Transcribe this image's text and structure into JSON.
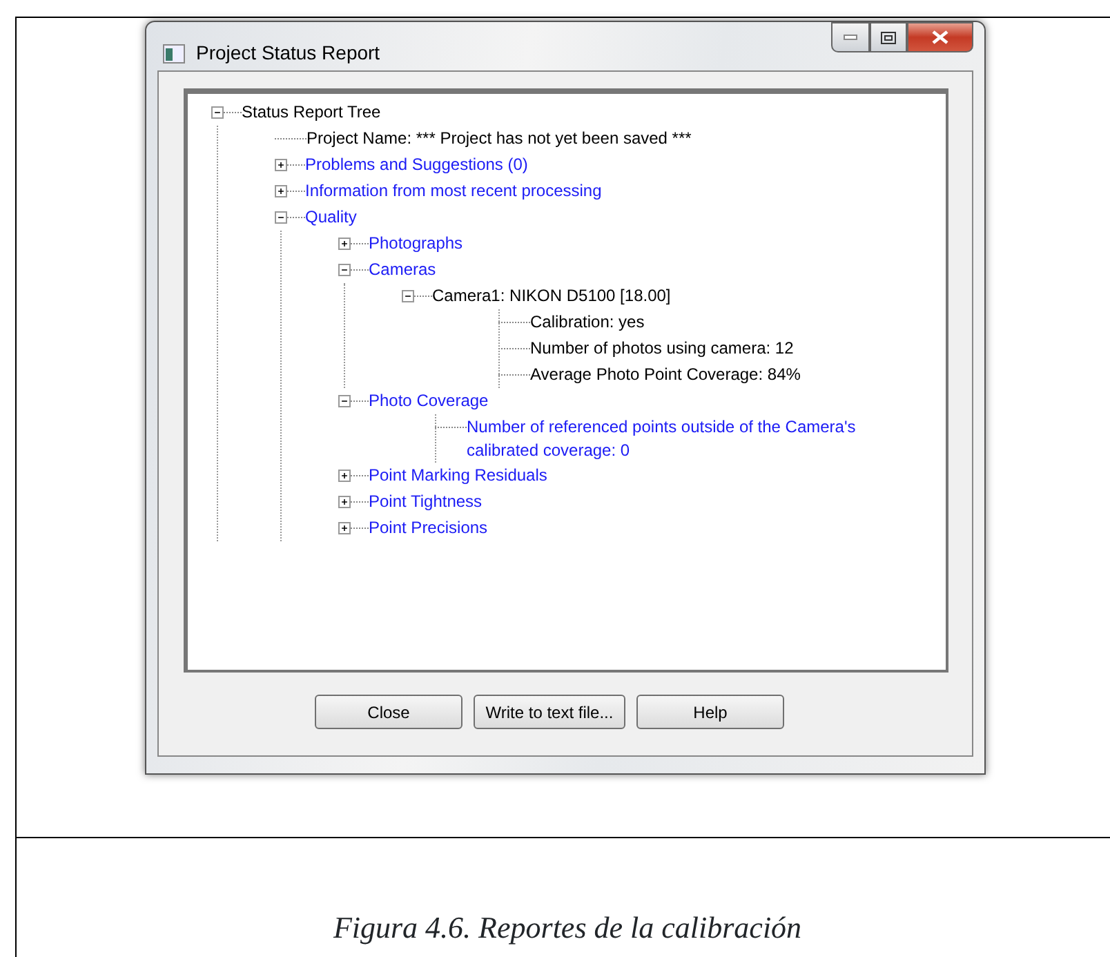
{
  "window": {
    "title": "Project Status Report"
  },
  "tree": [
    {
      "text": "Status Report Tree",
      "kind": "info",
      "expanded": true,
      "children": [
        {
          "text": "Project Name: *** Project has not yet been saved ***",
          "kind": "info"
        },
        {
          "text": "Problems and Suggestions (0)",
          "kind": "category",
          "expanded": false
        },
        {
          "text": "Information from most recent processing",
          "kind": "category",
          "expanded": false
        },
        {
          "text": "Quality",
          "kind": "category",
          "expanded": true,
          "children": [
            {
              "text": "Photographs",
              "kind": "category",
              "expanded": false
            },
            {
              "text": "Cameras",
              "kind": "category",
              "expanded": true,
              "children": [
                {
                  "text": "Camera1: NIKON D5100 [18.00]",
                  "kind": "info",
                  "expanded": true,
                  "children": [
                    {
                      "text": "Calibration: yes",
                      "kind": "info"
                    },
                    {
                      "text": "Number of photos using camera: 12",
                      "kind": "info"
                    },
                    {
                      "text": "Average Photo Point Coverage: 84%",
                      "kind": "info"
                    }
                  ]
                }
              ]
            },
            {
              "text": "Photo Coverage",
              "kind": "category",
              "expanded": true,
              "children": [
                {
                  "text": "Number of referenced points outside of the Camera's calibrated coverage: 0",
                  "kind": "category"
                }
              ]
            },
            {
              "text": "Point Marking Residuals",
              "kind": "category",
              "expanded": false
            },
            {
              "text": "Point Tightness",
              "kind": "category",
              "expanded": false
            },
            {
              "text": "Point Precisions",
              "kind": "category",
              "expanded": false
            }
          ]
        }
      ]
    }
  ],
  "buttons": [
    "Close",
    "Write to text file...",
    "Help"
  ],
  "caption": "Figura 4.6. Reportes de la calibración"
}
